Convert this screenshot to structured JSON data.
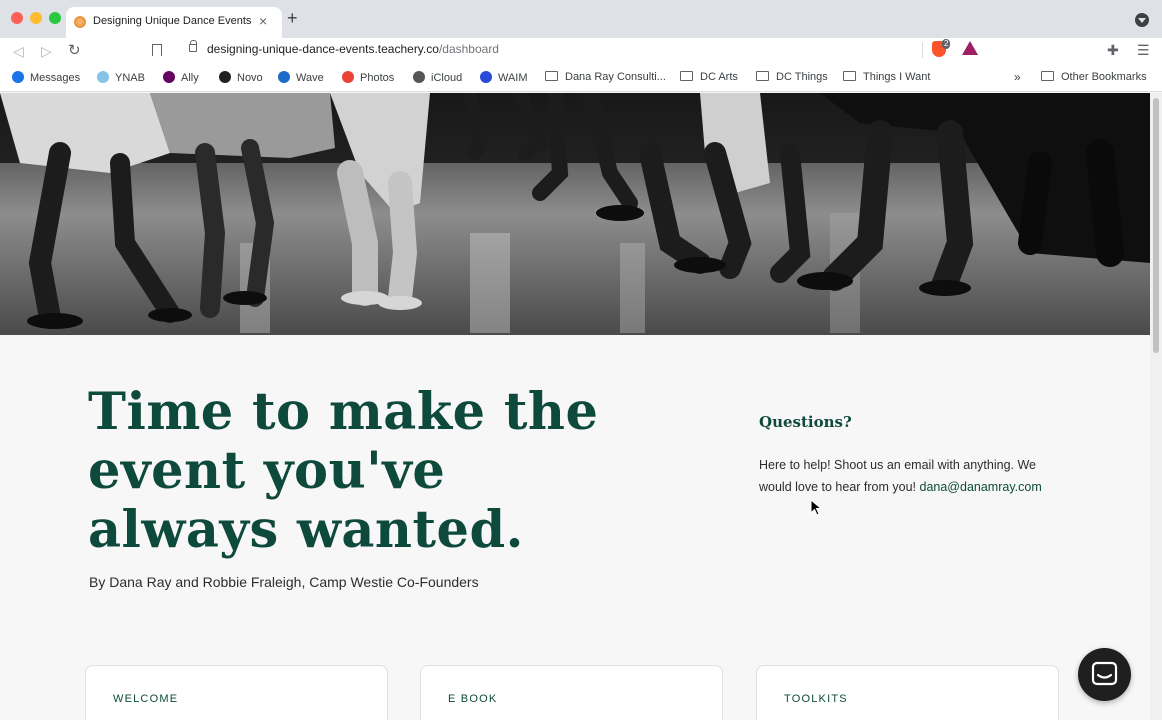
{
  "browser": {
    "tab": {
      "title": "Designing Unique Dance Events",
      "close_glyph": "×"
    },
    "new_tab_glyph": "+",
    "url": {
      "host": "designing-unique-dance-events.teachery.co",
      "path": "/dashboard"
    },
    "brave_badge": "2",
    "bookmarks": [
      {
        "label": "Messages",
        "icon": "messages-icon",
        "color": "#1a73e8"
      },
      {
        "label": "YNAB",
        "icon": "ynab-icon",
        "color": "#85c3e9"
      },
      {
        "label": "Ally",
        "icon": "ally-icon",
        "color": "#650360"
      },
      {
        "label": "Novo",
        "icon": "novo-icon",
        "color": "#222222"
      },
      {
        "label": "Wave",
        "icon": "wave-icon",
        "color": "#1c6ac9"
      },
      {
        "label": "Photos",
        "icon": "photos-icon",
        "color": "#ea4335"
      },
      {
        "label": "iCloud",
        "icon": "apple-icon",
        "color": "#555555"
      },
      {
        "label": "WAIM",
        "icon": "waim-icon",
        "color": "#2a4bd7"
      },
      {
        "label": "Dana Ray Consulti...",
        "icon": "folder-icon"
      },
      {
        "label": "DC Arts",
        "icon": "folder-icon"
      },
      {
        "label": "DC Things",
        "icon": "folder-icon"
      },
      {
        "label": "Things I Want",
        "icon": "folder-icon"
      }
    ],
    "more_bookmarks_glyph": "»",
    "other_bookmarks": "Other Bookmarks"
  },
  "page": {
    "headline": "Time to make the event you've always wanted.",
    "byline": "By Dana Ray and Robbie Fraleigh, Camp Westie Co-Founders",
    "questions": {
      "title": "Questions?",
      "text": "Here to help! Shoot us an email with anything. We would love to hear from you! ",
      "email": "dana@danamray.com"
    },
    "cards": [
      {
        "label": "WELCOME"
      },
      {
        "label": "E BOOK"
      },
      {
        "label": "TOOLKITS"
      }
    ]
  },
  "colors": {
    "brand_green": "#0e4a3b",
    "page_bg": "#f7f7f7",
    "chat_bubble": "#1f1f1f"
  }
}
